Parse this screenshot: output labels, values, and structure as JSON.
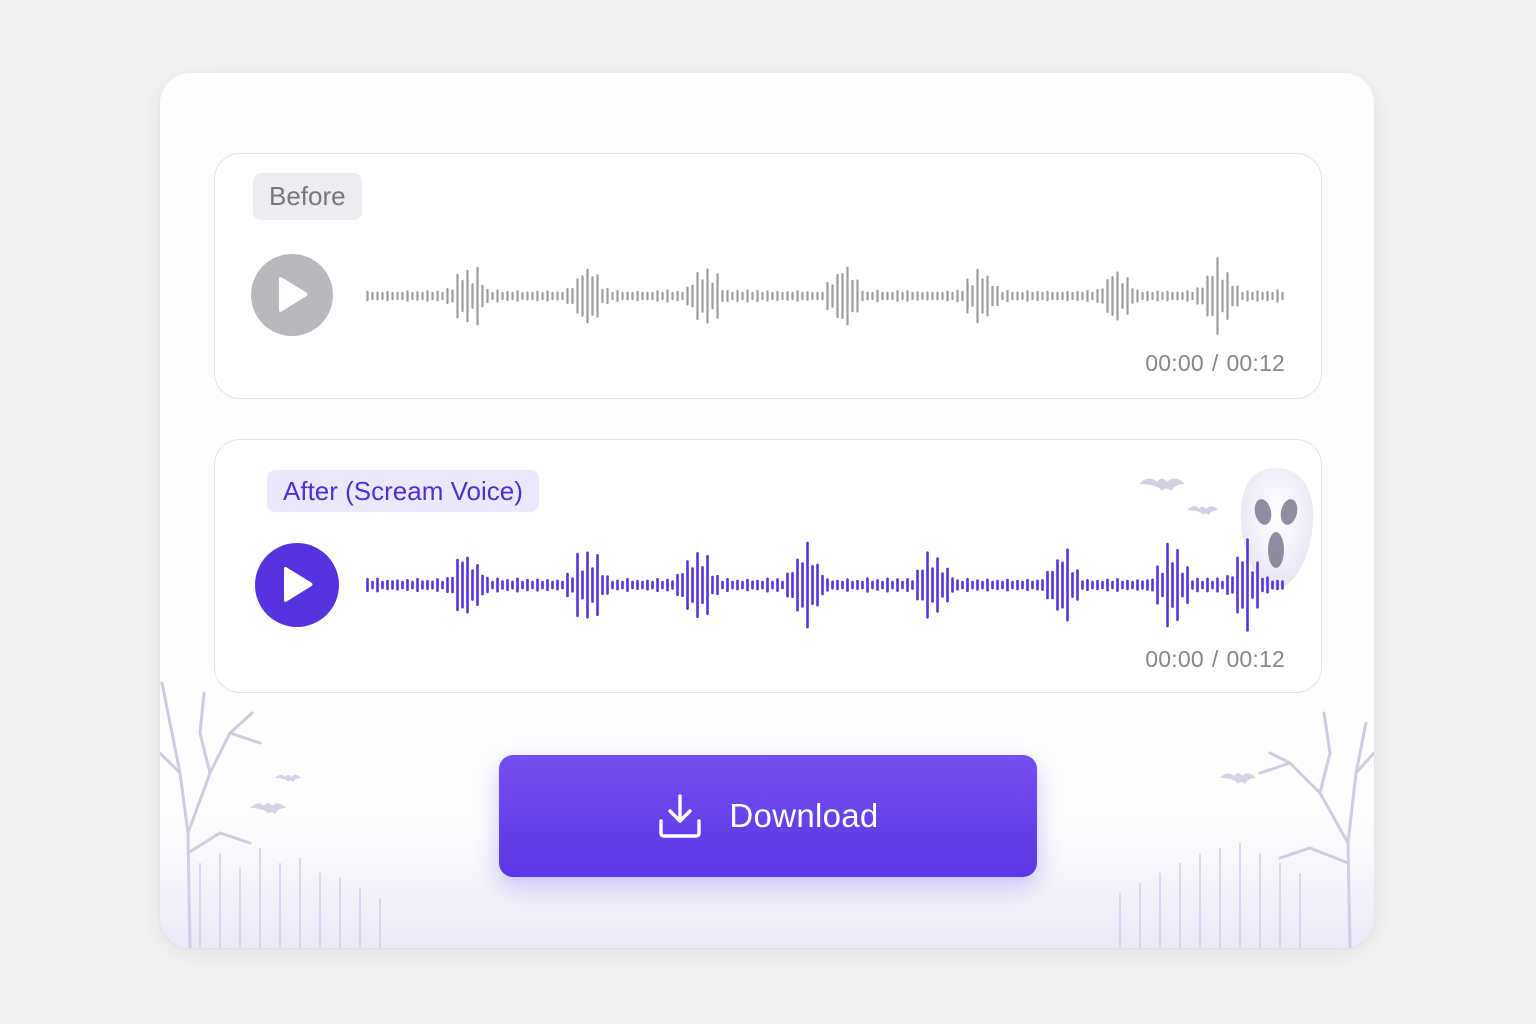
{
  "before": {
    "tag": "Before",
    "current_time": "00:00",
    "separator": "/",
    "duration": "00:12"
  },
  "after": {
    "tag": "After (Scream Voice)",
    "current_time": "00:00",
    "separator": "/",
    "duration": "00:12"
  },
  "download": {
    "label": "Download"
  },
  "icons": {
    "play": "play-icon",
    "download": "download-icon",
    "ghost": "ghost-mask-icon",
    "bats": "bat-icon",
    "trees": "bare-tree-icon"
  },
  "colors": {
    "accent": "#5533de",
    "button": "#6a46eb",
    "before_wave": "#9b9ba0",
    "after_wave": "#5533de",
    "tag_after_bg": "#ece8fb",
    "tag_before_bg": "#ededef"
  }
}
